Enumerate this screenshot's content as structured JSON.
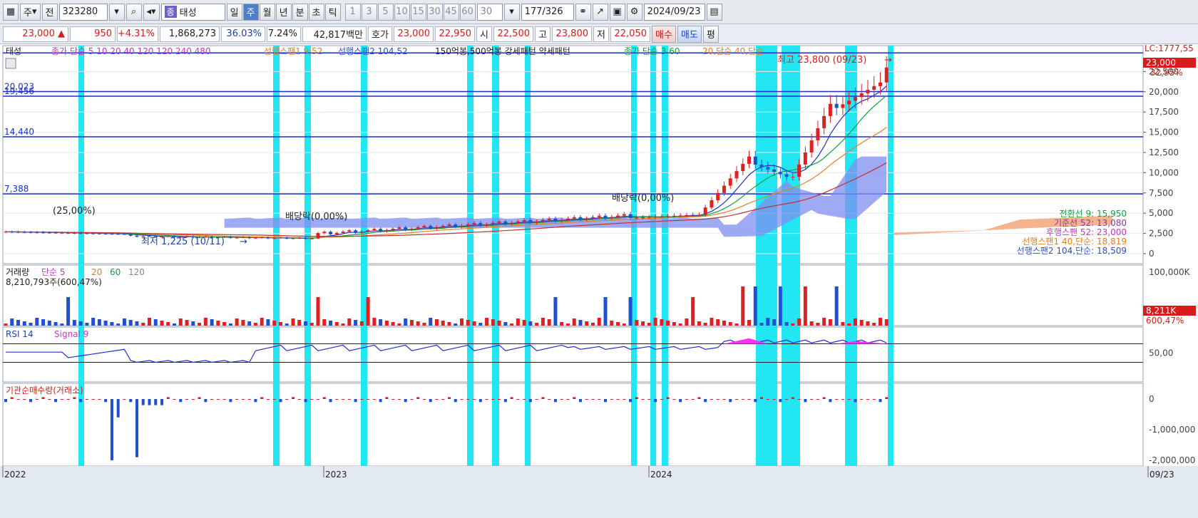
{
  "toolbar": {
    "mode": "주",
    "prev": "전",
    "code": "323280",
    "name": "태성",
    "periods": [
      "일",
      "주",
      "월",
      "년",
      "분",
      "초",
      "틱"
    ],
    "active_period": "주",
    "nums": [
      "1",
      "3",
      "5",
      "10",
      "15",
      "30",
      "45",
      "60"
    ],
    "count": "30",
    "page": "177/326",
    "date": "2024/09/23"
  },
  "quote": {
    "price": "23,000",
    "arrow": "▲",
    "change": "950",
    "pct": "+4.31%",
    "volume": "1,868,273",
    "ratio": "36.03%",
    "turnover": "7.24%",
    "amount": "42,817백만",
    "bid_label": "호가",
    "ask": "23,000",
    "bid": "22,950",
    "open_label": "시",
    "open": "22,500",
    "high_label": "고",
    "high": "23,800",
    "low_label": "저",
    "low": "22,050",
    "buy": "매수",
    "sell": "매도",
    "avg": "평"
  },
  "legend": {
    "name": "태성",
    "ma": "종가 단순 5  10  20  40  120  120  240  480",
    "span1": "선행스팬1 9,52",
    "span2": "선행스팬2 104,52",
    "pattern": "150억봉,500억봉 강세패턴  약세패턴",
    "ma2": "종가 단순 3  60",
    "ma3": "20,단순  40,단순"
  },
  "levels": [
    {
      "label": "20,023",
      "v": 20023
    },
    {
      "label": "19,456",
      "v": 19456
    },
    {
      "label": "14,440",
      "v": 14440
    },
    {
      "label": "7,388",
      "v": 7388
    }
  ],
  "annotations": {
    "high": "최고 23,800 (09/23)",
    "low": "최저 1,225 (10/11)",
    "div1": "(25,00%)",
    "div2": "배당락(0,00%)",
    "div3": "배당락(0,00%)"
  },
  "right_labels": {
    "lc": "LC:1777,55",
    "price": "23,000",
    "pct": "32,95%",
    "ichi1": "전환선 9: 15,950",
    "ichi2": "기준선 52: 13,080",
    "ichi3": "후행스팬 52: 23,000",
    "ichi4": "선행스팬1 40,단순: 18,819",
    "ichi5": "선행스팬2 104,단순: 18,509",
    "vol": "8,211K",
    "volpct": "600,47%"
  },
  "vol_legend": {
    "title": "거래량",
    "ma": "단순 5",
    "ma20": "20",
    "ma60": "60",
    "ma120": "120",
    "value": "8,210,793주(600,47%)"
  },
  "rsi_legend": {
    "title": "RSI 14",
    "signal": "Signal 9"
  },
  "inst_legend": {
    "title": "기관순매수량(거래소)"
  },
  "x_labels": [
    "2022",
    "2023",
    "2024",
    "09/23"
  ],
  "chart_data": {
    "type": "candlestick",
    "title": "태성 (323280) 주봉",
    "price_axis": {
      "ticks": [
        "0",
        "2,500",
        "5,000",
        "7,500",
        "10,000",
        "12,500",
        "15,000",
        "17,500",
        "20,000",
        "22,500"
      ],
      "ylim": [
        0,
        25000
      ]
    },
    "vol_axis": {
      "ticks": [
        "100,000K"
      ]
    },
    "rsi_axis": {
      "ticks": [
        "50,00"
      ],
      "lines": [
        70,
        30
      ]
    },
    "inst_axis": {
      "ticks": [
        "0",
        "-1,000,000",
        "-2,000,000"
      ]
    },
    "x_axis": {
      "start": "2022-01",
      "end": "2024-09-23"
    },
    "candles_recent": [
      {
        "date": "2024-06",
        "c": 5000
      },
      {
        "date": "2024-07",
        "c": 12000
      },
      {
        "date": "2024-07",
        "c": 9500
      },
      {
        "date": "2024-08",
        "c": 17500
      },
      {
        "date": "2024-09-23",
        "o": 22500,
        "h": 23800,
        "l": 22050,
        "c": 23000
      }
    ],
    "cyan_bands": 8
  }
}
